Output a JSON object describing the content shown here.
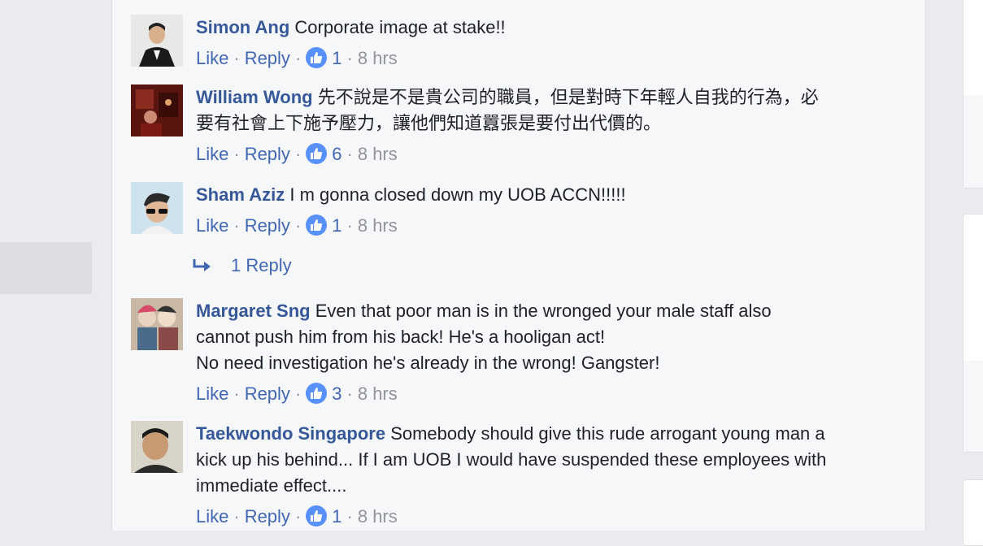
{
  "comments": [
    {
      "author": "Simon Ang",
      "text": "Corporate image at stake!!",
      "actions": {
        "like": "Like",
        "reply": "Reply",
        "reactions": "1",
        "time": "8 hrs"
      }
    },
    {
      "author": "William Wong",
      "text": "先不說是不是貴公司的職員，但是對時下年輕人自我的行為，必\n要有社會上下施予壓力，讓他們知道囂張是要付出代價的。",
      "actions": {
        "like": "Like",
        "reply": "Reply",
        "reactions": "6",
        "time": "8 hrs"
      }
    },
    {
      "author": "Sham Aziz",
      "text": "I m gonna closed down my UOB ACCN!!!!!",
      "actions": {
        "like": "Like",
        "reply": "Reply",
        "reactions": "1",
        "time": "8 hrs"
      },
      "replies_link": "1 Reply"
    },
    {
      "author": "Margaret Sng",
      "text": "Even that poor man is in the wronged your male staff also\ncannot push him from his back! He's a hooligan act!\nNo need investigation he's already in the wrong! Gangster!",
      "actions": {
        "like": "Like",
        "reply": "Reply",
        "reactions": "3",
        "time": "8 hrs"
      }
    },
    {
      "author": "Taekwondo Singapore",
      "text": "Somebody should give this rude arrogant young man a\nkick up his behind... If I am UOB I would have suspended these employees with\nimmediate effect....",
      "actions": {
        "like": "Like",
        "reply": "Reply",
        "reactions": "1",
        "time": "8 hrs"
      }
    }
  ],
  "icons": {
    "reaction": "like-thumb-icon",
    "reply_arrow": "reply-arrow-icon"
  },
  "colors": {
    "author": "#365899",
    "link": "#4267b2",
    "muted": "#90949c",
    "like_badge": "#5890ff"
  }
}
